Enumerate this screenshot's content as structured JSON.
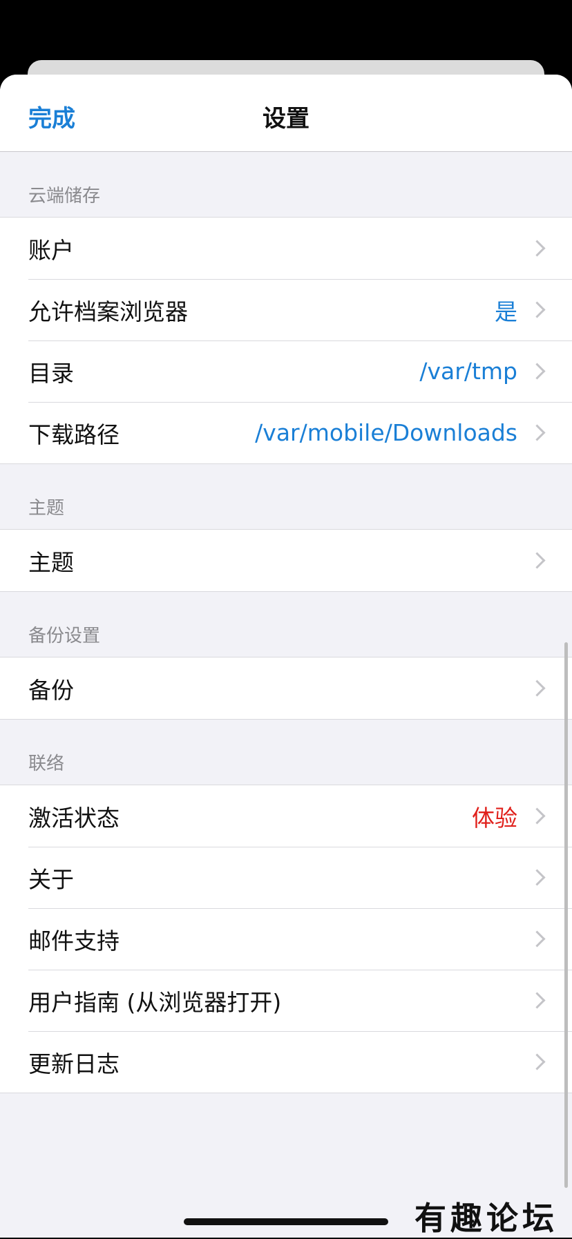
{
  "nav": {
    "done_label": "完成",
    "title": "设置"
  },
  "sections": [
    {
      "header": "云端储存",
      "rows": [
        {
          "label": "账户",
          "value": "",
          "value_color": ""
        },
        {
          "label": "允许档案浏览器",
          "value": "是",
          "value_color": "#1a7fd6"
        },
        {
          "label": "目录",
          "value": "/var/tmp",
          "value_color": "#1a7fd6"
        },
        {
          "label": "下载路径",
          "value": "/var/mobile/Downloads",
          "value_color": "#1a7fd6"
        }
      ]
    },
    {
      "header": "主题",
      "rows": [
        {
          "label": "主题",
          "value": "",
          "value_color": ""
        }
      ]
    },
    {
      "header": "备份设置",
      "rows": [
        {
          "label": "备份",
          "value": "",
          "value_color": ""
        }
      ]
    },
    {
      "header": "联络",
      "rows": [
        {
          "label": "激活状态",
          "value": "体验",
          "value_color": "#e0201b"
        },
        {
          "label": "关于",
          "value": "",
          "value_color": ""
        },
        {
          "label": "邮件支持",
          "value": "",
          "value_color": ""
        },
        {
          "label": "用户指南 (从浏览器打开)",
          "value": "",
          "value_color": ""
        },
        {
          "label": "更新日志",
          "value": "",
          "value_color": ""
        }
      ]
    }
  ],
  "watermark": "有趣论坛",
  "icons": {
    "chevron": "chevron-right-icon"
  },
  "colors": {
    "accent": "#1a7fd6",
    "warning": "#e0201b"
  }
}
